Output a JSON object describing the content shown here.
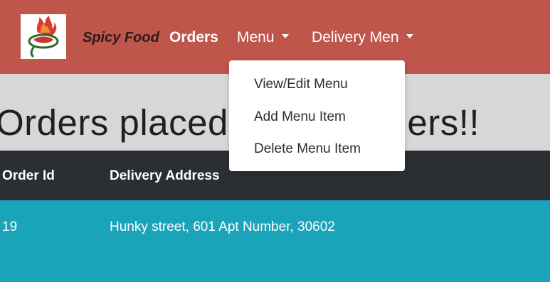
{
  "navbar": {
    "logo_icon": "chili-food-logo-icon",
    "brand": "Spicy Food",
    "links": [
      {
        "label": "Orders",
        "active": true
      },
      {
        "label": "Menu",
        "dropdown": true
      },
      {
        "label": "Delivery Men",
        "dropdown": true
      }
    ],
    "background": "#bf564c"
  },
  "menu_dropdown": {
    "items": [
      "View/Edit Menu",
      "Add Menu Item",
      "Delete Menu Item"
    ]
  },
  "banner": {
    "title": "Orders placed by customers!!"
  },
  "orders_table": {
    "columns": [
      "Order Id",
      "Delivery Address"
    ],
    "rows": [
      [
        "19",
        "Hunky street, 601 Apt Number, 30602"
      ]
    ],
    "header_color": "#2b2e32",
    "row_color": "#19a4ba"
  }
}
